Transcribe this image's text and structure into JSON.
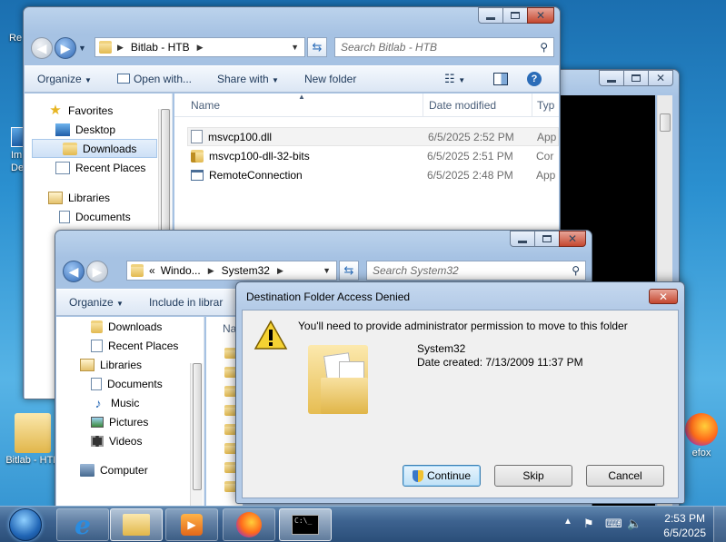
{
  "desktop": {
    "icons": [
      {
        "label": "Re",
        "icon": "recycle-bin-icon"
      },
      {
        "label": "Im De",
        "icon": "shortcut-icon"
      },
      {
        "label": "Bitlab - HTB",
        "icon": "folder-icon"
      },
      {
        "label": "efox",
        "icon": "firefox-icon"
      }
    ]
  },
  "explorer1": {
    "address": {
      "segments": [
        "Bitlab - HTB"
      ]
    },
    "search_placeholder": "Search Bitlab - HTB",
    "toolbar": {
      "organize": "Organize",
      "open_with": "Open with...",
      "share_with": "Share with",
      "new_folder": "New folder"
    },
    "nav": {
      "favorites": "Favorites",
      "desktop": "Desktop",
      "downloads": "Downloads",
      "recent_places": "Recent Places",
      "libraries": "Libraries",
      "documents": "Documents"
    },
    "columns": {
      "name": "Name",
      "date_modified": "Date modified",
      "type": "Typ"
    },
    "files": [
      {
        "name": "msvcp100.dll",
        "date": "6/5/2025 2:52 PM",
        "type": "App",
        "icon": "dll-file-icon"
      },
      {
        "name": "msvcp100-dll-32-bits",
        "date": "6/5/2025 2:51 PM",
        "type": "Cor",
        "icon": "compressed-folder-icon"
      },
      {
        "name": "RemoteConnection",
        "date": "6/5/2025 2:48 PM",
        "type": "App",
        "icon": "application-icon"
      }
    ]
  },
  "explorer2": {
    "address": {
      "overflow": "«",
      "segments": [
        "Windo...",
        "System32"
      ]
    },
    "search_placeholder": "Search System32",
    "toolbar": {
      "organize": "Organize",
      "include": "Include in librar"
    },
    "nav": {
      "downloads": "Downloads",
      "recent_places": "Recent Places",
      "libraries": "Libraries",
      "documents": "Documents",
      "music": "Music",
      "pictures": "Pictures",
      "videos": "Videos",
      "computer": "Computer"
    },
    "columns": {
      "name": "Na"
    }
  },
  "dialog": {
    "title": "Destination Folder Access Denied",
    "message": "You'll need to provide administrator permission to move to this folder",
    "folder_name": "System32",
    "date_created": "Date created: 7/13/2009 11:37 PM",
    "buttons": {
      "continue": "Continue",
      "skip": "Skip",
      "cancel": "Cancel"
    }
  },
  "taskbar": {
    "clock_time": "2:53 PM",
    "clock_date": "6/5/2025",
    "cmd_glyph": "C:\\_"
  },
  "colors": {
    "accent": "#2b6cb8",
    "close_red": "#c4472f"
  }
}
